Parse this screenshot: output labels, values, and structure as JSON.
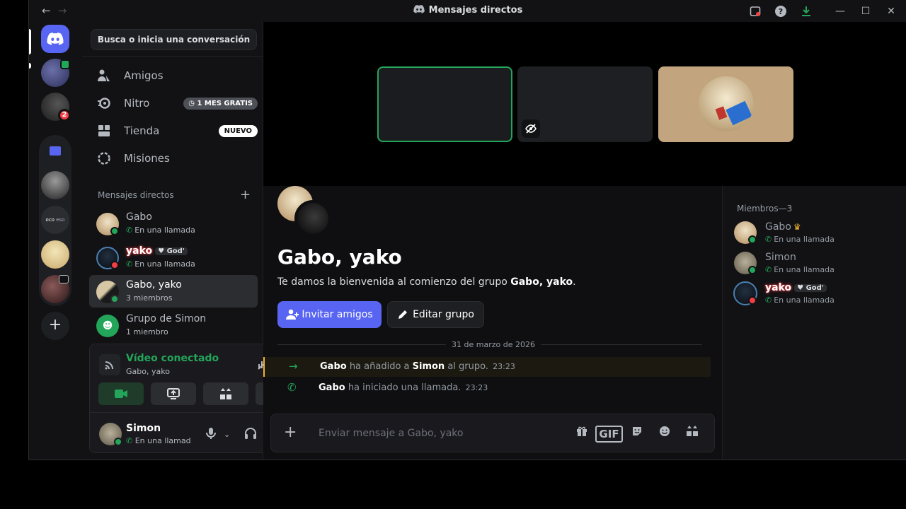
{
  "titlebar": {
    "back_icon": "arrow-left-icon",
    "forward_icon": "arrow-right-icon",
    "title": "Mensajes directos",
    "icons": [
      "inbox-icon",
      "help-icon",
      "download-icon",
      "minimize-icon",
      "maximize-icon",
      "close-icon"
    ]
  },
  "servers": {
    "badge_count": "2",
    "folder_label": "oco",
    "folder_label2": "eso"
  },
  "sidebar": {
    "search_label": "Busca o inicia una conversación",
    "nav": [
      {
        "label": "Amigos",
        "icon": "friends-icon"
      },
      {
        "label": "Nitro",
        "icon": "nitro-icon",
        "badge": "1 MES GRATIS"
      },
      {
        "label": "Tienda",
        "icon": "shop-icon",
        "badge": "NUEVO"
      },
      {
        "label": "Misiones",
        "icon": "quests-icon"
      }
    ],
    "dm_header": "Mensajes directos",
    "dms": [
      {
        "name": "Gabo",
        "sub": "En una llamada"
      },
      {
        "name": "yako",
        "tag": "God'",
        "sub": "En una llamada"
      },
      {
        "name": "Gabo, yako",
        "sub": "3 miembros"
      },
      {
        "name": "Grupo de Simon",
        "sub": "1 miembro"
      }
    ]
  },
  "voice": {
    "title": "Vídeo conectado",
    "channel": "Gabo, yako",
    "buttons": [
      "camera-icon",
      "screenshare-icon",
      "activities-icon",
      "soundboard-icon"
    ]
  },
  "user": {
    "name": "Simon",
    "status": "En una llamada"
  },
  "chat": {
    "title": "Gabo, yako",
    "welcome_prefix": "Te damos la bienvenida al comienzo del grupo ",
    "welcome_name": "Gabo, yako",
    "welcome_suffix": ".",
    "invite_label": "Invitar amigos",
    "edit_label": "Editar grupo",
    "date": "31 de marzo de 2026",
    "messages": [
      {
        "actor": "Gabo",
        "mid": " ha añadido a ",
        "target": "Simon",
        "end": " al grupo.",
        "time": "23:23"
      },
      {
        "actor": "Gabo",
        "mid": " ha iniciado una llamada.",
        "time": "23:23"
      }
    ],
    "placeholder": "Enviar mensaje a Gabo, yako"
  },
  "members": {
    "header": "Miembros—3",
    "list": [
      {
        "name": "Gabo",
        "sub": "En una llamada"
      },
      {
        "name": "Simon",
        "sub": "En una llamada"
      },
      {
        "name": "yako",
        "tag": "God'",
        "sub": "En una llamada"
      }
    ]
  },
  "colors": {
    "accent": "#5865f2",
    "online": "#23a55a",
    "dnd": "#f23f43",
    "owner_crown": "#f0b232"
  }
}
